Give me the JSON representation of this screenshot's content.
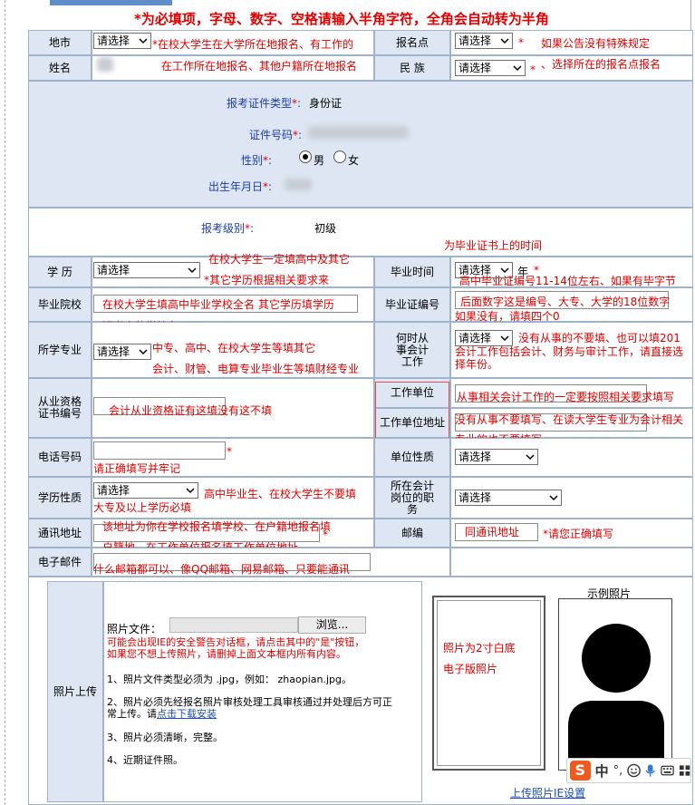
{
  "header": {
    "note": "*为必填项，字母、数字、空格请输入半角字符，全角会自动转为半角"
  },
  "select_default": "请选择",
  "labels": {
    "location": "地市",
    "exam_site": "报名点",
    "name": "姓名",
    "ethnicity": "民 族",
    "cert_type": "报考证件类型",
    "cert_no": "证件号码",
    "gender": "性别",
    "birth": "出生年月日",
    "level": "报考级别",
    "education": "学 历",
    "grad_time": "毕业时间",
    "school": "毕业院校",
    "grad_cert_no": "毕业证编号",
    "major": "所学专业",
    "work_time": "何时从事会计工作",
    "qual_no": "从业资格证书编号",
    "employer": "工作单位",
    "employer_addr": "工作单位地址",
    "phone": "电话号码",
    "unit_type": "单位性质",
    "edu_type": "学历性质",
    "position": "所在会计岗位的职务",
    "address": "通讯地址",
    "postcode": "邮编",
    "email": "电子邮件",
    "photo_upload": "照片上传",
    "sample_photo": "示例照片"
  },
  "values": {
    "cert_type": "身份证",
    "male": "男",
    "female": "女",
    "level": "初级",
    "year": "年",
    "postcode": "同通讯地址"
  },
  "asterisk": "*",
  "notes": {
    "loc1": "*在校大学生在大学所在地报名、有工作的",
    "loc2": "在工作所在地报名、其他户籍所在地报名",
    "site1": "如果公告没有特殊规定",
    "site2": "、选择所在的报名点报名",
    "grad_time": "为毕业证书上的时间",
    "edu1": "在校大学生一定填高中及其它",
    "edu2": "其它学历根据相关要求来",
    "cert1": "高中毕业证编号11-14位左右、如果有毕字节",
    "cert2": "后面数字这是编号、大专、大学的18位数字",
    "cert3": "如果没有，请填四个0",
    "school1": "在校大学生填高中毕业学校全名  其它学历填学历",
    "school2": "证书上的学校名",
    "major1": "中专、高中、在校大学生等填其它",
    "major2": "会计、财管、电算专业毕业生等填财经专业",
    "work1": "没有从事的不要填、也可以填201",
    "work2": "会计工作包括会计、财务与审计工作，请直接选择年份。",
    "qual": "会计从业资格证有这填没有这不填",
    "emp1": "从事相关会计工作的一定要按照相关要求填写",
    "emp2": "没有从事不要填写、在读大学生专业为会计相关",
    "emp3": "专业的也不要填写",
    "phone": "请正确填写并牢记",
    "edutype1": "高中毕业生、在校大学生不要填",
    "edutype2": "大专及以上学历必填",
    "addr1": "该地址为你在学校报名填学校、在户籍地报名填",
    "addr2": "户籍地、在工作单位报名填工作单位地址",
    "post": "*请您正确填写",
    "email": "什么邮箱都可以、像QQ邮箱、网易邮箱、只要能通讯"
  },
  "upload": {
    "file_label": "照片文件：",
    "browse": "浏览...",
    "warn1": "可能会出现IE的安全警告对话框，请点击其中的\"是\"按钮，",
    "warn2": "如果您不想上传照片，请删掉上面文本框内所有内容。",
    "r1": "1、照片文件类型必须为 .jpg，例如：  zhaopian.jpg。",
    "r2a": "2、照片必须先经报名照片审核处理工具审核通过并处理后方可正",
    "r2b": "常上传。请",
    "r2link": "点击下载安装",
    "r3": "3、照片必须清晰，完整。",
    "r4": "4、近期证件照。",
    "photo_note1": "照片为2寸白底",
    "photo_note2": "电子版照片",
    "ie_link": "上传照片IE设置"
  },
  "ime": {
    "logo": "S",
    "lang": "中",
    "punct": "°,"
  }
}
